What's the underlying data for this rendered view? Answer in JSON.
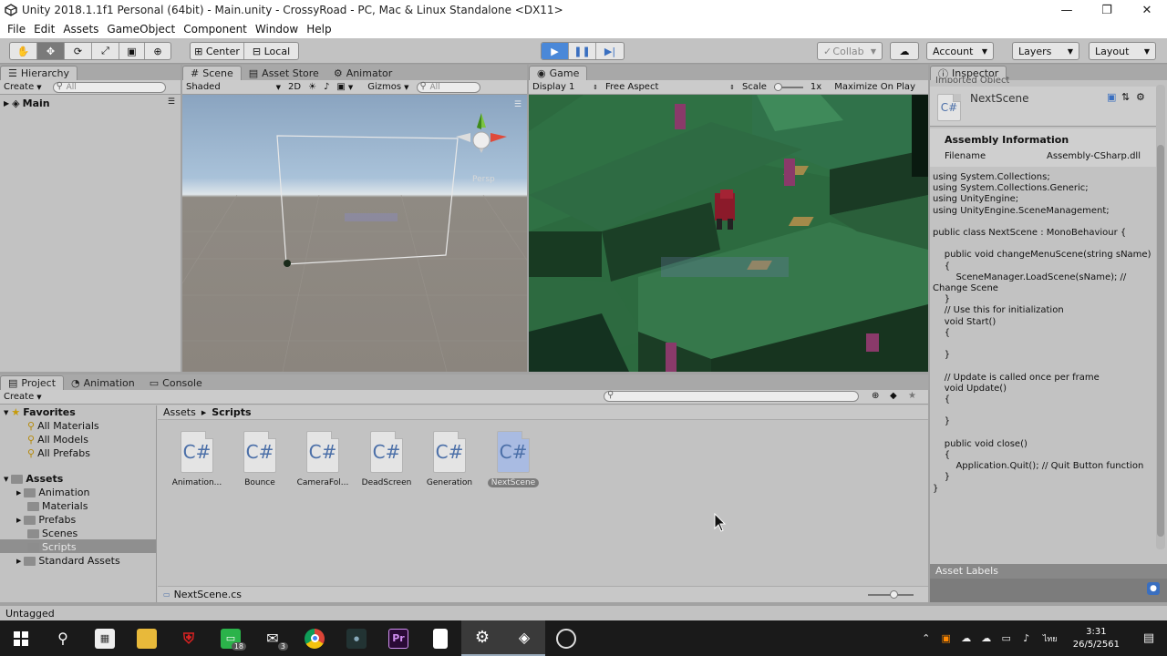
{
  "window": {
    "title": "Unity 2018.1.1f1 Personal (64bit) - Main.unity - CrossyRoad - PC, Mac & Linux Standalone <DX11>",
    "controls": [
      "—",
      "❐",
      "✕"
    ]
  },
  "menu": [
    "File",
    "Edit",
    "Assets",
    "GameObject",
    "Component",
    "Window",
    "Help"
  ],
  "toolbar": {
    "tools": [
      "✋",
      "✥",
      "⟳",
      "⤢",
      "▣",
      "⊕"
    ],
    "pivot": "Center",
    "space": "Local",
    "play_icons": [
      "▶",
      "❚❚",
      "▶|"
    ],
    "collab": "Collab",
    "account": "Account",
    "layers": "Layers",
    "layout": "Layout"
  },
  "hierarchy": {
    "tab": "Hierarchy",
    "create": "Create",
    "search_placeholder": "All",
    "root": "Main"
  },
  "scene": {
    "tabs": [
      "Scene",
      "Asset Store",
      "Animator"
    ],
    "shading": "Shaded",
    "mode_2d": "2D",
    "gizmos": "Gizmos",
    "search_placeholder": "All",
    "persp": "Persp"
  },
  "game": {
    "tab": "Game",
    "display": "Display 1",
    "aspect": "Free Aspect",
    "scale_label": "Scale",
    "scale_value": "1x",
    "maximize": "Maximize On Play"
  },
  "project": {
    "tabs": [
      "Project",
      "Animation",
      "Console"
    ],
    "create": "Create",
    "favorites": {
      "label": "Favorites",
      "items": [
        "All Materials",
        "All Models",
        "All Prefabs"
      ]
    },
    "assets": {
      "label": "Assets",
      "items": [
        "Animation",
        "Materials",
        "Prefabs",
        "Scenes",
        "Scripts",
        "Standard Assets"
      ]
    },
    "breadcrumb": [
      "Assets",
      "Scripts"
    ],
    "files": [
      "Animation...",
      "Bounce",
      "CameraFol...",
      "DeadScreen",
      "Generation",
      "NextScene"
    ],
    "selected_file": "NextScene",
    "footer_file": "NextScene.cs"
  },
  "inspector": {
    "tab": "Inspector",
    "header_partial": "Imported Object",
    "object_name": "NextScene",
    "section": "Assembly Information",
    "filename_label": "Filename",
    "filename_value": "Assembly-CSharp.dll",
    "code": "using System.Collections;\nusing System.Collections.Generic;\nusing UnityEngine;\nusing UnityEngine.SceneManagement;\n\npublic class NextScene : MonoBehaviour {\n\n    public void changeMenuScene(string sName)\n    {\n        SceneManager.LoadScene(sName); // Change Scene\n    }\n    // Use this for initialization\n    void Start()\n    {\n\n    }\n\n    // Update is called once per frame\n    void Update()\n    {\n\n    }\n\n    public void close()\n    {\n        Application.Quit(); // Quit Button function\n    }\n}",
    "asset_labels": "Asset Labels"
  },
  "status": {
    "text": "Untagged"
  },
  "taskbar": {
    "badges": [
      "18",
      "3"
    ],
    "lang": "ไทย",
    "time": "3:31",
    "date": "26/5/2561"
  },
  "colors": {
    "play_active": "#4a88d8",
    "editor_bg": "#c2c2c2",
    "grass": "#2f6e42",
    "selection": "#7a7a7a"
  }
}
